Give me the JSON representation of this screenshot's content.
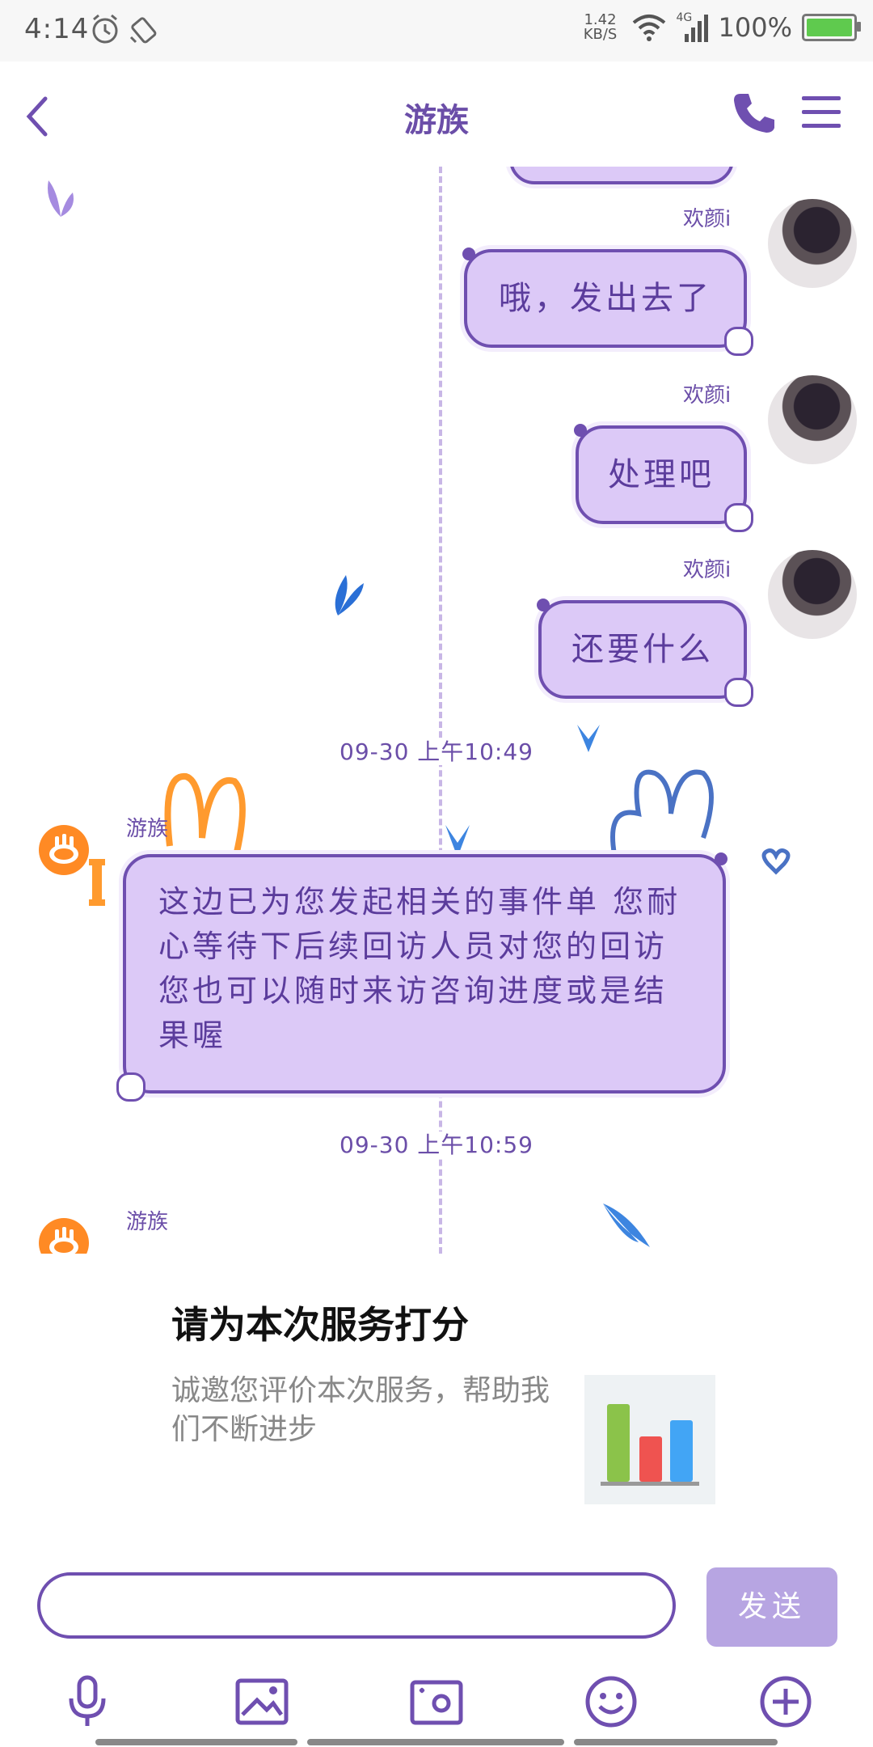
{
  "status_bar": {
    "time": "4:14",
    "net_speed_value": "1.42",
    "net_speed_unit": "KB/S",
    "network": "4G",
    "battery": "100%",
    "icons": [
      "alarm-icon",
      "rotate-icon",
      "wifi-icon",
      "signal-icon",
      "battery-icon"
    ]
  },
  "header": {
    "title": "游族",
    "back_icon": "chevron-left-icon",
    "call_icon": "phone-icon",
    "menu_icon": "menu-icon"
  },
  "messages": [
    {
      "sender": "欢颜i",
      "text": "哦，发出去了",
      "side": "right"
    },
    {
      "sender": "欢颜i",
      "text": "处理吧",
      "side": "right"
    },
    {
      "sender": "欢颜i",
      "text": "还要什么",
      "side": "right"
    },
    {
      "timestamp": "09-30 上午10:49"
    },
    {
      "sender": "游族",
      "text": "这边已为您发起相关的事件单 您耐心等待下后续回访人员对您的回访 您也可以随时来访咨询进度或是结果喔",
      "side": "left"
    },
    {
      "timestamp": "09-30 上午10:59"
    },
    {
      "sender": "游族",
      "side": "left"
    }
  ],
  "rating_card": {
    "title": "请为本次服务打分",
    "description": "诚邀您评价本次服务，帮助我们不断进步"
  },
  "input_bar": {
    "placeholder": "",
    "send_label": "发送"
  },
  "toolbar_icons": [
    "microphone-icon",
    "image-icon",
    "camera-icon",
    "emoji-icon",
    "add-icon"
  ],
  "colors": {
    "accent": "#6f4fb0",
    "bubble": "#dcc9f7",
    "send_button": "#b7a5e2"
  }
}
